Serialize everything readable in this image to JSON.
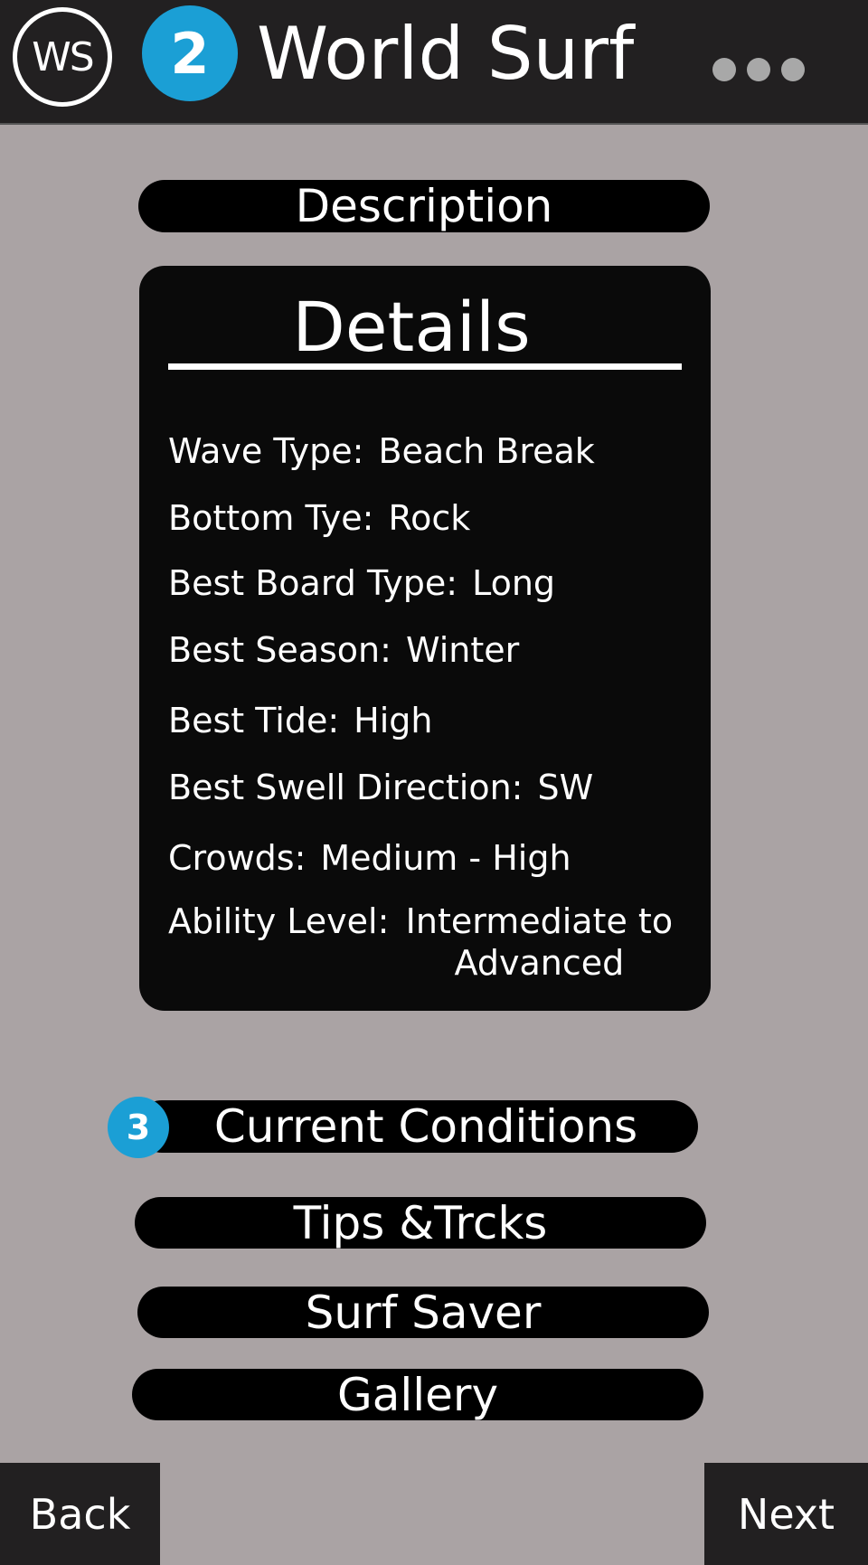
{
  "header": {
    "logo_text": "WS",
    "step_badge": "2",
    "title": "World Surf",
    "more_icon": "more-dots-icon"
  },
  "menu": {
    "description_label": "Description",
    "current_conditions_label": "Current Conditions",
    "current_conditions_badge": "3",
    "tips_label": "Tips &Trcks",
    "surf_saver_label": "Surf Saver",
    "gallery_label": "Gallery"
  },
  "details": {
    "title": "Details",
    "rows": [
      {
        "label": "Wave Type:",
        "value": "Beach Break"
      },
      {
        "label": "Bottom Tye:",
        "value": "Rock"
      },
      {
        "label": "Best Board Type:",
        "value": "Long"
      },
      {
        "label": "Best Season:",
        "value": "Winter"
      },
      {
        "label": "Best Tide:",
        "value": "High"
      },
      {
        "label": "Best Swell Direction:",
        "value": "SW"
      },
      {
        "label": "Crowds:",
        "value": "Medium - High"
      },
      {
        "label": "Ability Level:",
        "value": "Intermediate to Advanced"
      }
    ]
  },
  "footer": {
    "back_label": "Back",
    "next_label": "Next"
  },
  "colors": {
    "background": "#aaa3a4",
    "header": "#222021",
    "accent": "#1b9fd5",
    "pill": "#000000"
  }
}
